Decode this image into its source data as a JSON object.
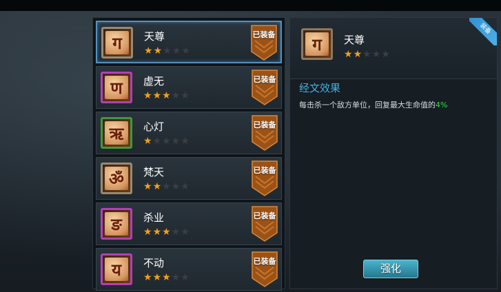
{
  "scriptures": [
    {
      "name": "天尊",
      "glyph": "ग",
      "stars": 2,
      "badge": "已装备",
      "frame": "#9a8a70"
    },
    {
      "name": "虚无",
      "glyph": "ण",
      "stars": 3,
      "badge": "已装备",
      "frame": "#b43fb8"
    },
    {
      "name": "心灯",
      "glyph": "ऋ",
      "stars": 1,
      "badge": "已装备",
      "frame": "#3f9a3a"
    },
    {
      "name": "梵天",
      "glyph": "ॐ",
      "stars": 2,
      "badge": "已装备",
      "frame": "#9a8a70"
    },
    {
      "name": "杀业",
      "glyph": "ङ",
      "stars": 3,
      "badge": "已装备",
      "frame": "#b43fb8"
    },
    {
      "name": "不动",
      "glyph": "य",
      "stars": 3,
      "badge": "已装备",
      "frame": "#b43fb8"
    }
  ],
  "detail": {
    "name": "天尊",
    "glyph": "ग",
    "stars": 2,
    "corner_tag": "装备",
    "effect_title": "经文效果",
    "effect_text": "每击杀一个敌方单位，回复最大生命值的",
    "effect_value": "4%",
    "upgrade_label": "强化"
  },
  "colors": {
    "star_on": "#f2a11b",
    "star_off": "#3a3f44",
    "accent_blue": "#3fb0e0",
    "value_green": "#3fd94a"
  },
  "icons": {
    "star": "star-icon",
    "badge": "equipped-banner-icon"
  }
}
